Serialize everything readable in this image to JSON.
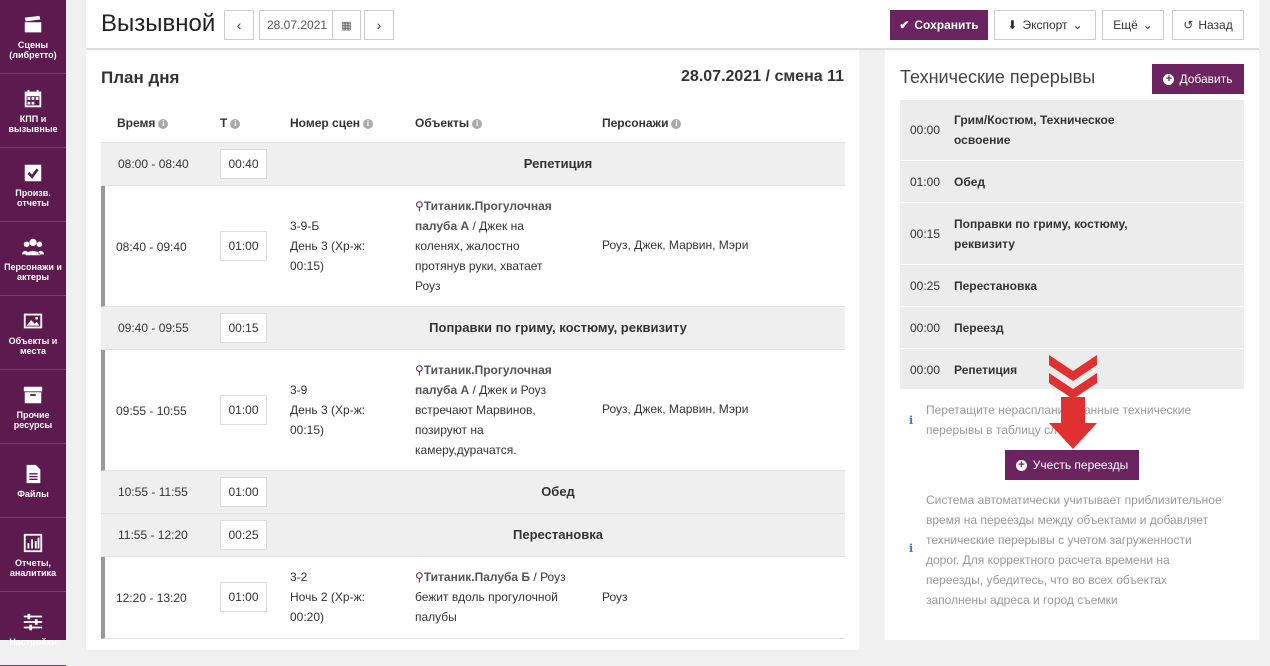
{
  "sidebar": {
    "items": [
      {
        "label": "Сцены (либретто)",
        "icon": "clapperboard-icon"
      },
      {
        "label": "КПП и вызывные",
        "icon": "calendar-icon"
      },
      {
        "label": "Произв. отчеты",
        "icon": "checkbox-icon"
      },
      {
        "label": "Персонажи и актеры",
        "icon": "people-icon"
      },
      {
        "label": "Объекты и места",
        "icon": "picture-icon"
      },
      {
        "label": "Прочие ресурсы",
        "icon": "archive-icon"
      },
      {
        "label": "Файлы",
        "icon": "file-icon"
      },
      {
        "label": "Отчеты, аналитика",
        "icon": "bar-chart-icon"
      },
      {
        "label": "Настройки",
        "icon": "sliders-icon"
      }
    ]
  },
  "header": {
    "title": "Вызывной",
    "prev": "‹",
    "next": "›",
    "date": "28.07.2021",
    "save": "Сохранить",
    "export": "Экспорт",
    "more": "Ещё",
    "back": "Назад"
  },
  "plan": {
    "title": "План дня",
    "date_shift": "28.07.2021 / смена 11",
    "columns": {
      "time": "Время",
      "t": "Т",
      "scenes": "Номер сцен",
      "objects": "Объекты",
      "characters": "Персонажи"
    },
    "rows": [
      {
        "time": "08:00 - 08:40",
        "t": "00:40",
        "title": "Репетиция"
      },
      {
        "time": "08:40 - 09:40",
        "t": "01:00",
        "scene": "3-9-Б",
        "day": "День 3 (Хр-ж: 00:15)",
        "object": "Титаник.Прогулочная палуба А",
        "desc": "Джек на коленях, жалостно протянув руки, хватает Роуз",
        "chars": "Роуз, Джек, Марвин, Мэри"
      },
      {
        "time": "09:40 - 09:55",
        "t": "00:15",
        "title": "Поправки по гриму, костюму, реквизиту"
      },
      {
        "time": "09:55 - 10:55",
        "t": "01:00",
        "scene": "3-9",
        "day": "День 3 (Хр-ж: 00:15)",
        "object": "Титаник.Прогулочная палуба А",
        "desc": "Джек и Роуз встречают Марвинов, позируют на камеру,дурачатся.",
        "chars": "Роуз, Джек, Марвин, Мэри"
      },
      {
        "time": "10:55 - 11:55",
        "t": "01:00",
        "title": "Обед"
      },
      {
        "time": "11:55 - 12:20",
        "t": "00:25",
        "title": "Перестановка"
      },
      {
        "time": "12:20 - 13:20",
        "t": "01:00",
        "scene": "3-2",
        "day": "Ночь 2 (Хр-ж: 00:20)",
        "object": "Титаник.Палуба Б",
        "desc": "Роуз бежит вдоль прогулочной палубы",
        "chars": "Роуз"
      }
    ]
  },
  "tech": {
    "title": "Технические перерывы",
    "add": "Добавить",
    "items": [
      {
        "time": "00:00",
        "name": "Грим/Костюм, Техническое освоение"
      },
      {
        "time": "01:00",
        "name": "Обед"
      },
      {
        "time": "00:15",
        "name": "Поправки по гриму, костюму, реквизиту"
      },
      {
        "time": "00:25",
        "name": "Перестановка"
      },
      {
        "time": "00:00",
        "name": "Переезд"
      },
      {
        "time": "00:00",
        "name": "Репетиция"
      }
    ],
    "drag_hint": "Перетащите нераспланированные технические перерывы в таблицу слева",
    "travel_button": "Учесть переезды",
    "travel_note": "Система автоматически учитывает приблизительное время на переезды между объектами и добавляет технические перерывы с учетом загруженности дорог. Для корректного расчета времени на переезды, убедитесь, что во всех объектах заполнены адреса и город съемки"
  },
  "colors": {
    "brand": "#6b2460",
    "sidebar": "#5c1a4f",
    "arrow": "#e03030"
  }
}
